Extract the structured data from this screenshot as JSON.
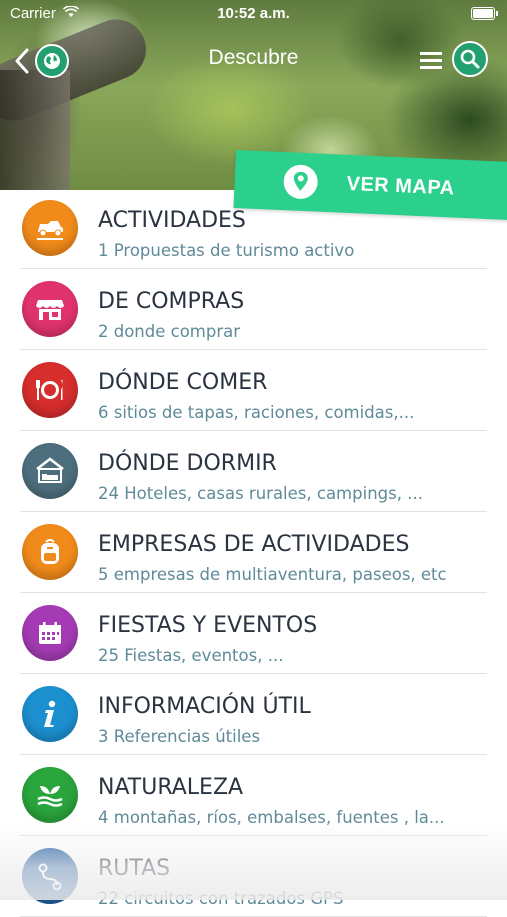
{
  "status_bar": {
    "carrier": "Carrier",
    "time": "10:52 a.m."
  },
  "nav": {
    "title": "Descubre"
  },
  "map_button": {
    "label": "VER MAPA",
    "color": "#2bd08d"
  },
  "categories": [
    {
      "name": "ACTIVIDADES",
      "desc": "1 Propuestas de turismo activo",
      "icon": "car-icon",
      "color": "#f08a1a"
    },
    {
      "name": "DE COMPRAS",
      "desc": "2 donde comprar",
      "icon": "shop-icon",
      "color": "#e0336e"
    },
    {
      "name": "DÓNDE COMER",
      "desc": "6 sitios de tapas, raciones, comidas,...",
      "icon": "plate-icon",
      "color": "#d62d2d"
    },
    {
      "name": "DÓNDE DORMIR",
      "desc": "24 Hoteles, casas rurales, campings, ...",
      "icon": "bed-icon",
      "color": "#4d6f7d"
    },
    {
      "name": "EMPRESAS DE ACTIVIDADES",
      "desc": "5 empresas de multiaventura, paseos, etc",
      "icon": "backpack-icon",
      "color": "#f08a1a"
    },
    {
      "name": "FIESTAS Y EVENTOS",
      "desc": "25 Fiestas, eventos, ...",
      "icon": "calendar-icon",
      "color": "#a43bb4"
    },
    {
      "name": "INFORMACIÓN ÚTIL",
      "desc": "3 Referencias útiles",
      "icon": "info-icon",
      "color": "#1c8fcf"
    },
    {
      "name": "NATURALEZA",
      "desc": "4  montañas, ríos, embalses, fuentes , la...",
      "icon": "leaf-icon",
      "color": "#2aa43c"
    },
    {
      "name": "RUTAS",
      "desc": "22 circuitos con trazados GPS",
      "icon": "route-icon",
      "color": "#225ea3"
    }
  ]
}
